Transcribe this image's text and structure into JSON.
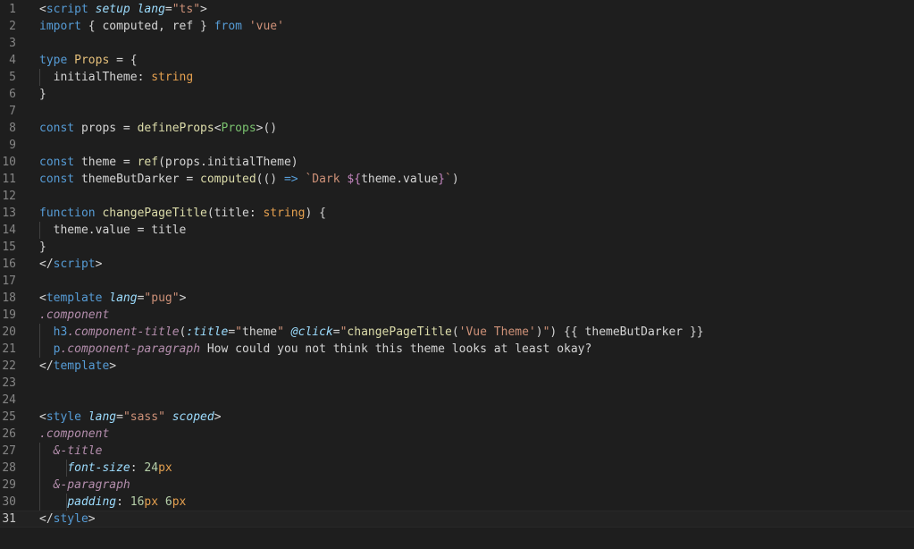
{
  "editor": {
    "active_line": 31,
    "lines": [
      {
        "n": "1",
        "tokens": [
          [
            "tag",
            "<"
          ],
          [
            "tn",
            "script"
          ],
          [
            "tag",
            " "
          ],
          [
            "attr",
            "setup"
          ],
          [
            "tag",
            " "
          ],
          [
            "attr",
            "lang"
          ],
          [
            "tag",
            "="
          ],
          [
            "str",
            "\"ts\""
          ],
          [
            "tag",
            ">"
          ]
        ]
      },
      {
        "n": "2",
        "tokens": [
          [
            "kw",
            "import"
          ],
          [
            "ident",
            " { computed, ref } "
          ],
          [
            "kw",
            "from"
          ],
          [
            "ident",
            " "
          ],
          [
            "str",
            "'vue'"
          ]
        ]
      },
      {
        "n": "3",
        "tokens": []
      },
      {
        "n": "4",
        "tokens": [
          [
            "kw",
            "type"
          ],
          [
            "ident",
            " "
          ],
          [
            "yellow",
            "Props"
          ],
          [
            "ident",
            " = {"
          ]
        ]
      },
      {
        "n": "5",
        "tokens": [
          [
            "ident",
            "  initialTheme"
          ],
          [
            "ident",
            ": "
          ],
          [
            "orange",
            "string"
          ]
        ]
      },
      {
        "n": "6",
        "tokens": [
          [
            "ident",
            "}"
          ]
        ]
      },
      {
        "n": "7",
        "tokens": []
      },
      {
        "n": "8",
        "tokens": [
          [
            "kw",
            "const"
          ],
          [
            "ident",
            " props = "
          ],
          [
            "fn",
            "defineProps"
          ],
          [
            "ident",
            "<"
          ],
          [
            "green",
            "Props"
          ],
          [
            "ident",
            ">()"
          ]
        ]
      },
      {
        "n": "9",
        "tokens": []
      },
      {
        "n": "10",
        "tokens": [
          [
            "kw",
            "const"
          ],
          [
            "ident",
            " theme = "
          ],
          [
            "fn",
            "ref"
          ],
          [
            "ident",
            "(props.initialTheme)"
          ]
        ]
      },
      {
        "n": "11",
        "tokens": [
          [
            "kw",
            "const"
          ],
          [
            "ident",
            " themeButDarker = "
          ],
          [
            "fn",
            "computed"
          ],
          [
            "ident",
            "(() "
          ],
          [
            "kw",
            "=>"
          ],
          [
            "ident",
            " "
          ],
          [
            "str",
            "`Dark "
          ],
          [
            "pink",
            "${"
          ],
          [
            "ident",
            "theme.value"
          ],
          [
            "pink",
            "}"
          ],
          [
            "str",
            "`"
          ],
          [
            "ident",
            ")"
          ]
        ]
      },
      {
        "n": "12",
        "tokens": []
      },
      {
        "n": "13",
        "tokens": [
          [
            "kw",
            "function"
          ],
          [
            "ident",
            " "
          ],
          [
            "fn",
            "changePageTitle"
          ],
          [
            "ident",
            "(title: "
          ],
          [
            "orange",
            "string"
          ],
          [
            "ident",
            ") {"
          ]
        ]
      },
      {
        "n": "14",
        "tokens": [
          [
            "ident",
            "  theme.value = title"
          ]
        ]
      },
      {
        "n": "15",
        "tokens": [
          [
            "ident",
            "}"
          ]
        ]
      },
      {
        "n": "16",
        "tokens": [
          [
            "tag",
            "</"
          ],
          [
            "tn",
            "script"
          ],
          [
            "tag",
            ">"
          ]
        ]
      },
      {
        "n": "17",
        "tokens": []
      },
      {
        "n": "18",
        "tokens": [
          [
            "tag",
            "<"
          ],
          [
            "tn",
            "template"
          ],
          [
            "tag",
            " "
          ],
          [
            "attr",
            "lang"
          ],
          [
            "tag",
            "="
          ],
          [
            "str",
            "\"pug\""
          ],
          [
            "tag",
            ">"
          ]
        ]
      },
      {
        "n": "19",
        "tokens": [
          [
            "purple",
            ".component"
          ]
        ]
      },
      {
        "n": "20",
        "tokens": [
          [
            "ident",
            "  "
          ],
          [
            "tn",
            "h3"
          ],
          [
            "purple",
            ".component-title"
          ],
          [
            "ident",
            "("
          ],
          [
            "attr",
            ":title"
          ],
          [
            "ident",
            "="
          ],
          [
            "str",
            "\""
          ],
          [
            "ident",
            "theme"
          ],
          [
            "str",
            "\""
          ],
          [
            "ident",
            " "
          ],
          [
            "attr",
            "@click"
          ],
          [
            "ident",
            "="
          ],
          [
            "str",
            "\""
          ],
          [
            "fn",
            "changePageTitle"
          ],
          [
            "ident",
            "("
          ],
          [
            "str",
            "'Vue Theme'"
          ],
          [
            "ident",
            ")"
          ],
          [
            "str",
            "\""
          ],
          [
            "ident",
            ") {{ themeButDarker }}"
          ]
        ]
      },
      {
        "n": "21",
        "tokens": [
          [
            "ident",
            "  "
          ],
          [
            "tn",
            "p"
          ],
          [
            "purple",
            ".component-paragraph"
          ],
          [
            "ident",
            " How could you not think this theme looks at least okay?"
          ]
        ]
      },
      {
        "n": "22",
        "tokens": [
          [
            "tag",
            "</"
          ],
          [
            "tn",
            "template"
          ],
          [
            "tag",
            ">"
          ]
        ]
      },
      {
        "n": "23",
        "tokens": []
      },
      {
        "n": "24",
        "tokens": []
      },
      {
        "n": "25",
        "tokens": [
          [
            "tag",
            "<"
          ],
          [
            "tn",
            "style"
          ],
          [
            "tag",
            " "
          ],
          [
            "attr",
            "lang"
          ],
          [
            "tag",
            "="
          ],
          [
            "str",
            "\"sass\""
          ],
          [
            "tag",
            " "
          ],
          [
            "attr",
            "scoped"
          ],
          [
            "tag",
            ">"
          ]
        ]
      },
      {
        "n": "26",
        "tokens": [
          [
            "purple",
            ".component"
          ]
        ]
      },
      {
        "n": "27",
        "tokens": [
          [
            "ident",
            "  "
          ],
          [
            "purple",
            "&-title"
          ]
        ]
      },
      {
        "n": "28",
        "tokens": [
          [
            "ident",
            "    "
          ],
          [
            "attr",
            "font-size"
          ],
          [
            "ident",
            ": "
          ],
          [
            "num",
            "24"
          ],
          [
            "orange",
            "px"
          ]
        ]
      },
      {
        "n": "29",
        "tokens": [
          [
            "ident",
            "  "
          ],
          [
            "purple",
            "&-paragraph"
          ]
        ]
      },
      {
        "n": "30",
        "tokens": [
          [
            "ident",
            "    "
          ],
          [
            "attr",
            "padding"
          ],
          [
            "ident",
            ": "
          ],
          [
            "num",
            "16"
          ],
          [
            "orange",
            "px"
          ],
          [
            "ident",
            " "
          ],
          [
            "num",
            "6"
          ],
          [
            "orange",
            "px"
          ]
        ]
      },
      {
        "n": "31",
        "tokens": [
          [
            "tag",
            "</"
          ],
          [
            "tn",
            "style"
          ],
          [
            "tag",
            ">"
          ]
        ]
      }
    ]
  },
  "colors": {
    "background": "#1e1e1e",
    "line_number": "#858585",
    "keyword": "#569cd6",
    "string": "#ce9178",
    "function": "#dcdcaa",
    "type": "#4ec9b0",
    "attribute": "#9cdcfe"
  }
}
